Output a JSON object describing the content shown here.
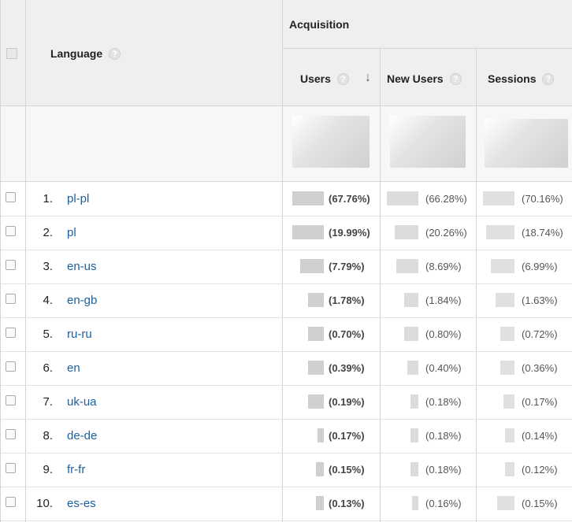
{
  "header": {
    "dimension_label": "Language",
    "group_label": "Acquisition",
    "metrics": [
      "Users",
      "New Users",
      "Sessions"
    ],
    "help_glyph": "?",
    "sort_glyph": "↓"
  },
  "rows": [
    {
      "num": "1.",
      "lang": "pl-pl",
      "users_pct": "(67.76%)",
      "new_users_pct": "(66.28%)",
      "sessions_pct": "(70.16%)"
    },
    {
      "num": "2.",
      "lang": "pl",
      "users_pct": "(19.99%)",
      "new_users_pct": "(20.26%)",
      "sessions_pct": "(18.74%)"
    },
    {
      "num": "3.",
      "lang": "en-us",
      "users_pct": "(7.79%)",
      "new_users_pct": "(8.69%)",
      "sessions_pct": "(6.99%)"
    },
    {
      "num": "4.",
      "lang": "en-gb",
      "users_pct": "(1.78%)",
      "new_users_pct": "(1.84%)",
      "sessions_pct": "(1.63%)"
    },
    {
      "num": "5.",
      "lang": "ru-ru",
      "users_pct": "(0.70%)",
      "new_users_pct": "(0.80%)",
      "sessions_pct": "(0.72%)"
    },
    {
      "num": "6.",
      "lang": "en",
      "users_pct": "(0.39%)",
      "new_users_pct": "(0.40%)",
      "sessions_pct": "(0.36%)"
    },
    {
      "num": "7.",
      "lang": "uk-ua",
      "users_pct": "(0.19%)",
      "new_users_pct": "(0.18%)",
      "sessions_pct": "(0.17%)"
    },
    {
      "num": "8.",
      "lang": "de-de",
      "users_pct": "(0.17%)",
      "new_users_pct": "(0.18%)",
      "sessions_pct": "(0.14%)"
    },
    {
      "num": "9.",
      "lang": "fr-fr",
      "users_pct": "(0.15%)",
      "new_users_pct": "(0.18%)",
      "sessions_pct": "(0.12%)"
    },
    {
      "num": "10.",
      "lang": "es-es",
      "users_pct": "(0.13%)",
      "new_users_pct": "(0.16%)",
      "sessions_pct": "(0.15%)"
    }
  ]
}
